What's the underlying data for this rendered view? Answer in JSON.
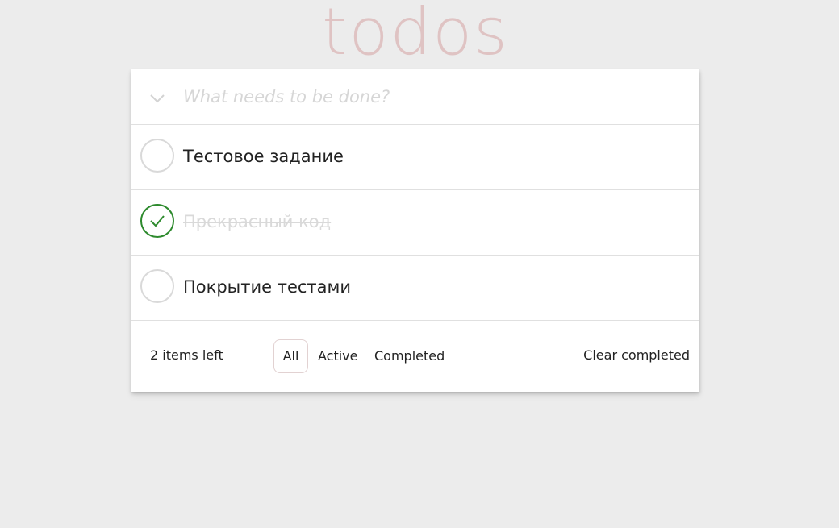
{
  "app": {
    "title": "todos"
  },
  "header": {
    "placeholder": "What needs to be done?",
    "toggle_icon": "chevron-down-icon"
  },
  "todos": [
    {
      "label": "Тестовое задание",
      "completed": false
    },
    {
      "label": "Прекрасный код",
      "completed": true
    },
    {
      "label": "Покрытие тестами",
      "completed": false
    }
  ],
  "footer": {
    "items_left": "2 items left",
    "filters": [
      {
        "label": "All",
        "selected": true
      },
      {
        "label": "Active",
        "selected": false
      },
      {
        "label": "Completed",
        "selected": false
      }
    ],
    "clear_label": "Clear completed"
  },
  "colors": {
    "background": "#ececec",
    "title": "#dfc3c3",
    "completed_check": "#2d8a2d",
    "completed_text": "#d9d9d9"
  }
}
